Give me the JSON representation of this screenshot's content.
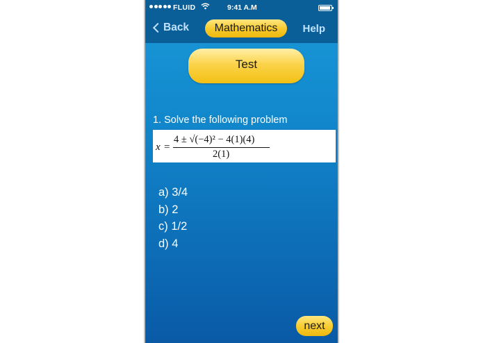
{
  "status_bar": {
    "carrier": "FLUID",
    "time": "9:41 A.M",
    "wifi_icon": "wifi-icon",
    "battery_icon": "battery-icon"
  },
  "nav": {
    "back_label": "Back",
    "title": "Mathematics",
    "help_label": "Help"
  },
  "test_button": {
    "label": "Test"
  },
  "question": {
    "text": "1. Solve the following problem",
    "formula": {
      "variable": "x",
      "equals": "=",
      "numerator": "4 ± √(−4)² − 4(1)(4)",
      "denominator": "2(1)"
    }
  },
  "options": [
    {
      "label": "a) 3/4"
    },
    {
      "label": "b) 2"
    },
    {
      "label": "c) 1/2"
    },
    {
      "label": "d) 4"
    }
  ],
  "next_button": {
    "label": "next"
  },
  "colors": {
    "background": "#1287cc",
    "topbar": "#0b5f99",
    "accent_yellow": "#f6c92a",
    "nav_text": "#bfe3ff"
  }
}
